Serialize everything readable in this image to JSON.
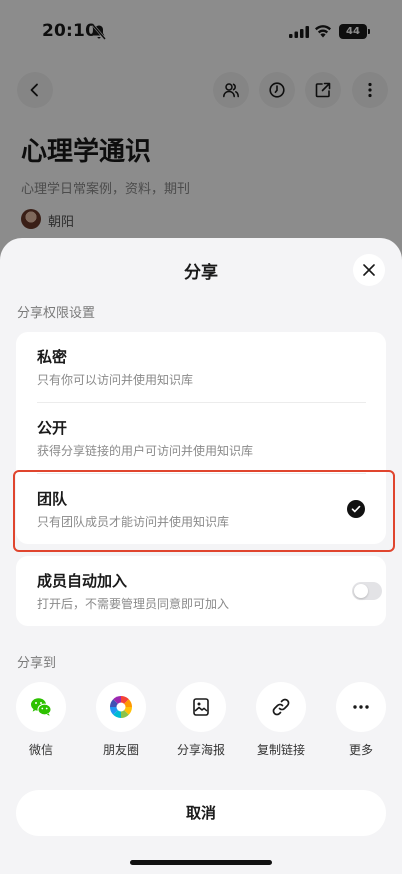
{
  "status_bar": {
    "time": "20:10",
    "battery": "44"
  },
  "page": {
    "title": "心理学通识",
    "description": "心理学日常案例，资料，期刊",
    "author": "朝阳"
  },
  "sheet": {
    "title": "分享",
    "permission_section": "分享权限设置",
    "options": [
      {
        "title": "私密",
        "subtitle": "只有你可以访问并使用知识库"
      },
      {
        "title": "公开",
        "subtitle": "获得分享链接的用户可访问并使用知识库"
      },
      {
        "title": "团队",
        "subtitle": "只有团队成员才能访问并使用知识库",
        "selected": true
      }
    ],
    "auto_join": {
      "title": "成员自动加入",
      "subtitle": "打开后，不需要管理员同意即可加入",
      "enabled": false
    },
    "share_to_section": "分享到",
    "share_targets": [
      {
        "label": "微信",
        "icon": "wechat-icon"
      },
      {
        "label": "朋友圈",
        "icon": "moments-icon"
      },
      {
        "label": "分享海报",
        "icon": "poster-icon"
      },
      {
        "label": "复制链接",
        "icon": "link-icon"
      },
      {
        "label": "更多",
        "icon": "more-icon"
      }
    ],
    "cancel": "取消"
  },
  "colors": {
    "highlight": "#e0452e",
    "wechat": "#2dc100"
  }
}
